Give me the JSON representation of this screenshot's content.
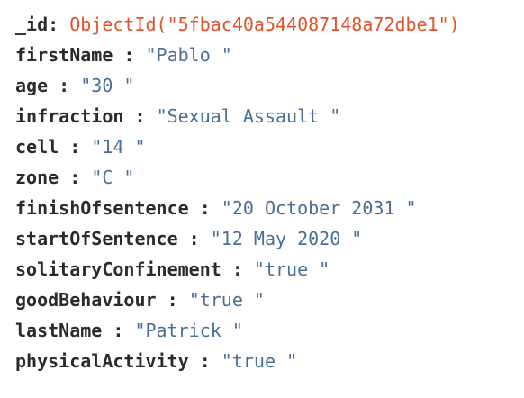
{
  "document": {
    "id_field": {
      "key": "_id",
      "separator": ":",
      "value": "ObjectId(\"5fbac40a544087148a72dbe1\")"
    },
    "fields": [
      {
        "key": "firstName",
        "separator": " :",
        "value": "\"Pablo \""
      },
      {
        "key": "age",
        "separator": " :",
        "value": "\"30 \""
      },
      {
        "key": "infraction",
        "separator": " :",
        "value": "\"Sexual Assault \""
      },
      {
        "key": "cell",
        "separator": " :",
        "value": "\"14 \""
      },
      {
        "key": "zone",
        "separator": " :",
        "value": "\"C \""
      },
      {
        "key": "finishOfsentence",
        "separator": " :",
        "value": "\"20 October 2031 \""
      },
      {
        "key": "startOfSentence",
        "separator": " :",
        "value": "\"12 May 2020 \""
      },
      {
        "key": "solitaryConfinement",
        "separator": " :",
        "value": "\"true \""
      },
      {
        "key": "goodBehaviour",
        "separator": " :",
        "value": "\"true \""
      },
      {
        "key": "lastName",
        "separator": " :",
        "value": "\"Patrick \""
      },
      {
        "key": "physicalActivity",
        "separator": " :",
        "value": "\"true \""
      }
    ]
  },
  "colors": {
    "key": "#2b2b2b",
    "string_value": "#4a6f96",
    "object_id": "#e1532a"
  }
}
